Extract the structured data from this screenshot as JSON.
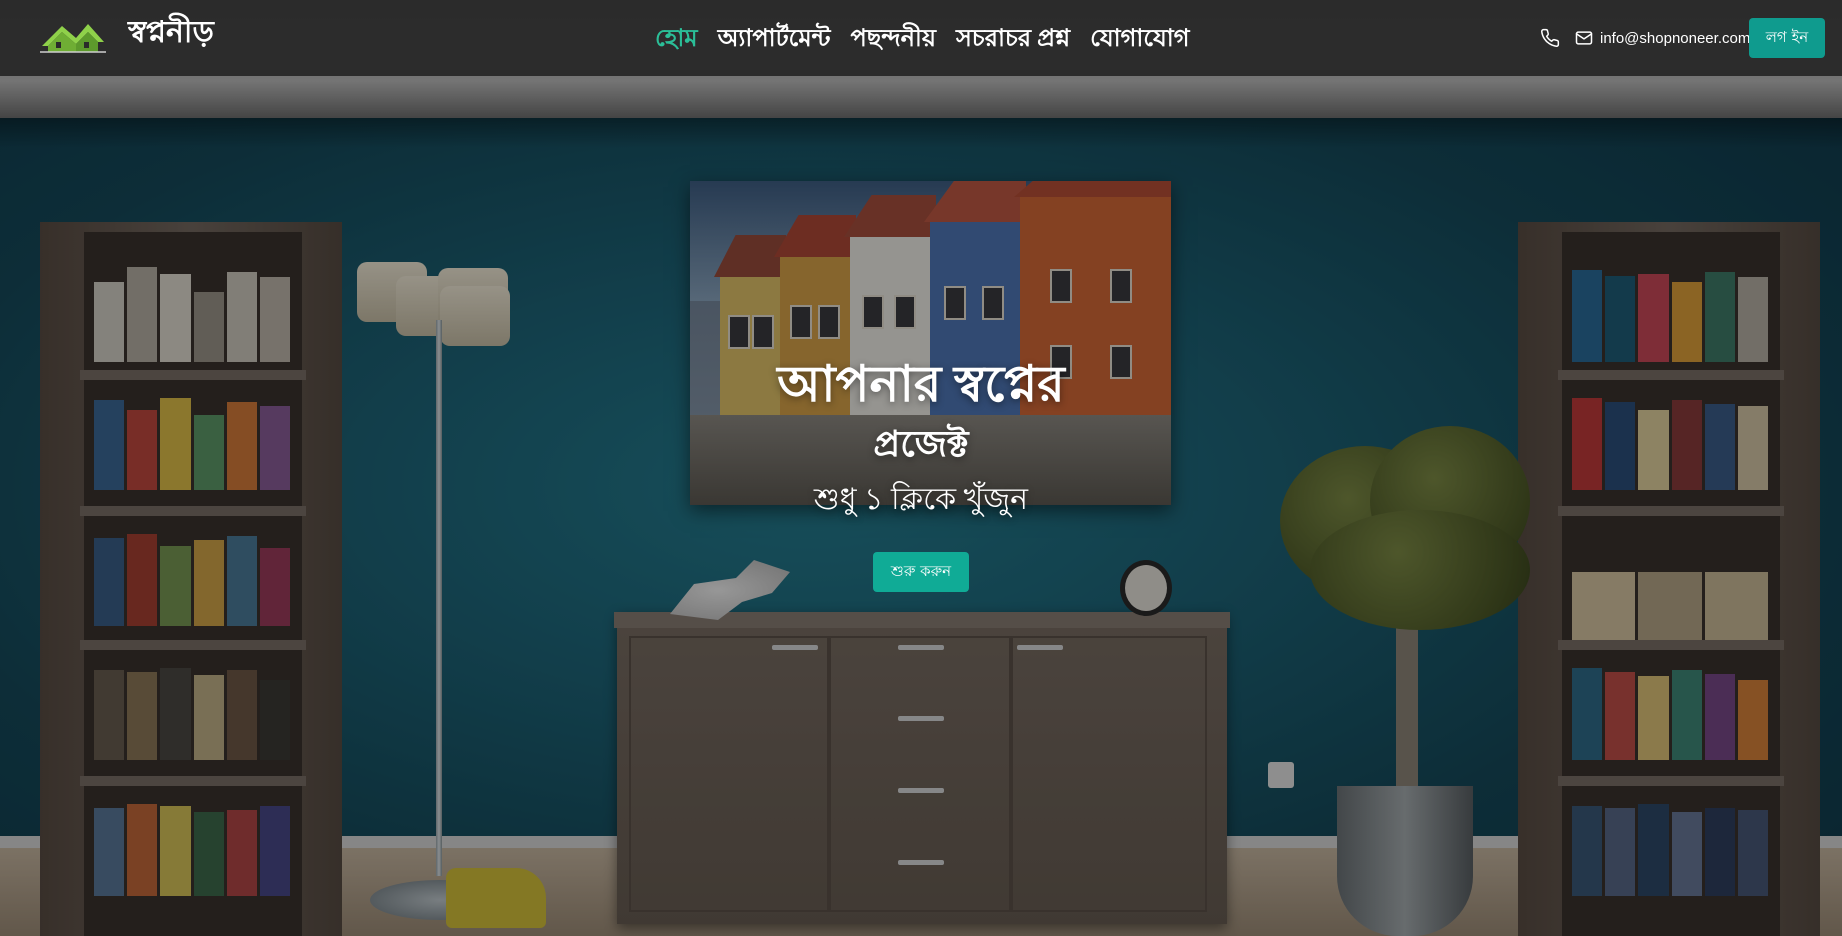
{
  "brand": {
    "name": "স্বপ্ননীড়",
    "logo_icon": "house-roof-logo"
  },
  "nav": {
    "items": [
      {
        "label": "হোম",
        "active": true
      },
      {
        "label": "অ্যাপার্টমেন্ট",
        "active": false
      },
      {
        "label": "পছন্দনীয়",
        "active": false
      },
      {
        "label": "সচরাচর প্রশ্ন",
        "active": false
      },
      {
        "label": "যোগাযোগ",
        "active": false
      }
    ]
  },
  "contact": {
    "phone_icon": "phone-icon",
    "mail_icon": "mail-icon",
    "email": "info@shopnoneer.com"
  },
  "login_label": "লগ ইন",
  "hero": {
    "line1": "আপনার স্বপ্নের",
    "line2": "প্রজেক্ট",
    "subtitle": "শুধু ১ ক্লিকে খুঁজুন",
    "cta_label": "শুরু করুন"
  },
  "colors": {
    "accent": "#2bbf98",
    "button": "#0f9b8e",
    "navbar": "#2a2a2a",
    "wall": "#1d6478"
  }
}
